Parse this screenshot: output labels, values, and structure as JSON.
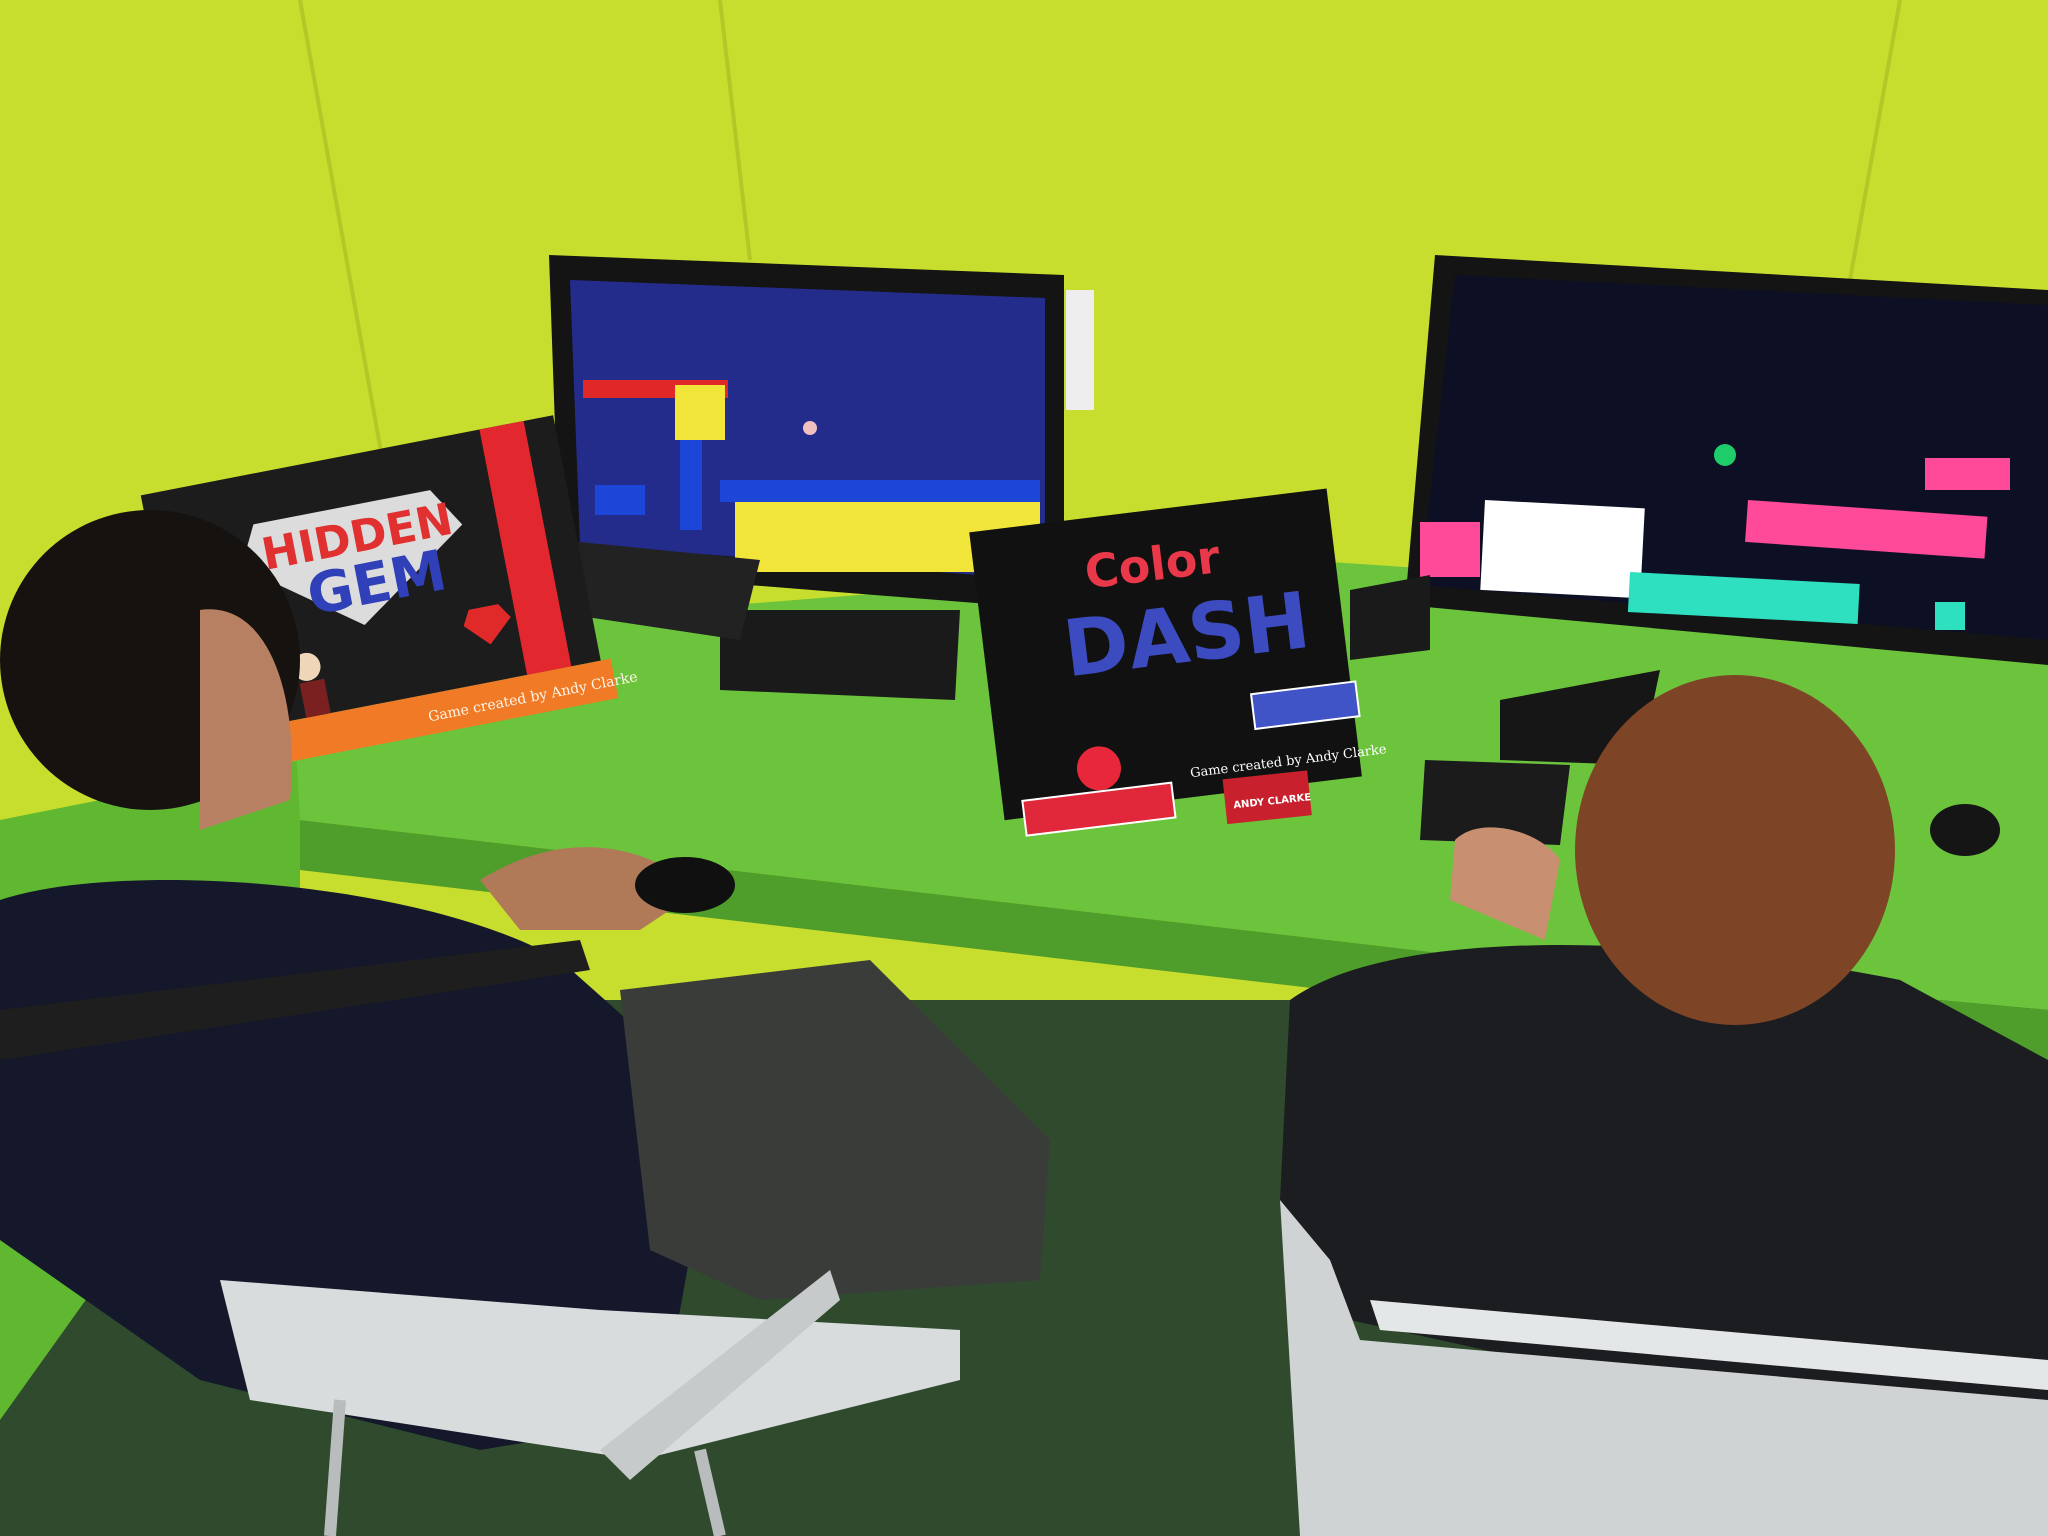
{
  "scene": "Two people playing student-made video games at a green computer desk",
  "colors": {
    "wall": "#c8de2e",
    "desk": "#6cc43c",
    "floor": "#2f4a2c",
    "left_screen": "#232c8a",
    "right_screen": "#0d1024",
    "shirt": "#14182a"
  },
  "signs": {
    "hidden_gem": {
      "title_line1": "HIDDEN",
      "title_line2": "GEM",
      "credit": "Game created by Andy Clarke"
    },
    "color_dash": {
      "title_line1": "Color",
      "title_line2": "DASH",
      "credit": "Game created by Andy Clarke"
    },
    "nameplate": "ANDY CLARKE"
  }
}
